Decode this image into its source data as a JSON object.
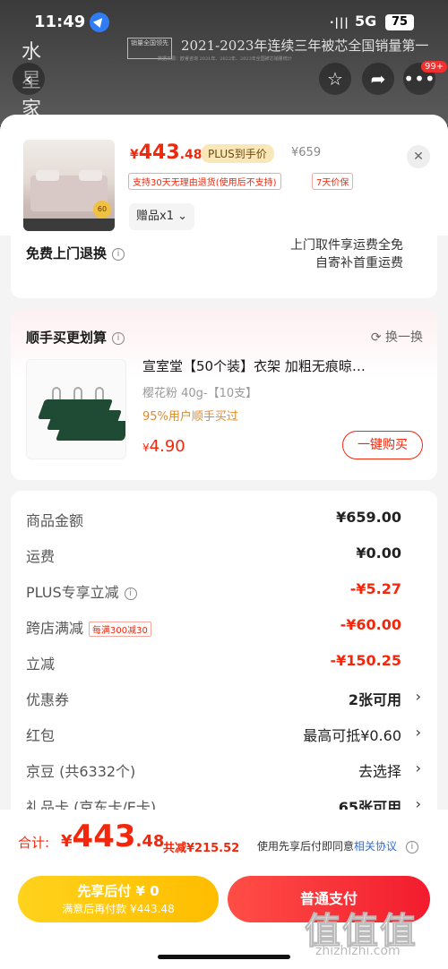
{
  "status_bar": {
    "time": "11:49",
    "signal": "·|||",
    "network": "5G",
    "battery": "75"
  },
  "banner": {
    "logo": "水星家纺",
    "badge": "销量全国领先",
    "slogan": "2021-2023年连续三年被芯全国销量第一",
    "fine_print": "数据来源：欧睿咨询 2021年、2022年、2023年全国被芯销量统计"
  },
  "nav": {
    "more_badge": "99+"
  },
  "product": {
    "currency": "¥",
    "price_int": "443",
    "price_dec": ".48",
    "plus_label": "PLUS到手价",
    "original_price": "¥659",
    "tags": [
      "支持30天无理由退货(使用后不支持)",
      "7天价保"
    ],
    "gift": "赠品x1",
    "thumb_badge": "60"
  },
  "return_service": {
    "title": "免费上门退换",
    "line1": "上门取件享运费全免",
    "line2": "自寄补首重运费"
  },
  "addon": {
    "title": "顺手买更划算",
    "refresh": "换一换",
    "name": "宣室堂【50个装】衣架 加粗无痕晾…",
    "spec": "樱花粉 40g-【10支】",
    "bought": "95%用户顺手买过",
    "currency": "¥",
    "price": "4.90",
    "buy_label": "一键购买"
  },
  "summary": [
    {
      "label": "商品金额",
      "value": "¥659.00",
      "style": "normal",
      "chevron": false
    },
    {
      "label": "运费",
      "value": "¥0.00",
      "style": "normal",
      "chevron": false
    },
    {
      "label": "PLUS专享立减",
      "value": "-¥5.27",
      "style": "red",
      "chevron": false,
      "info": true
    },
    {
      "label": "跨店满减",
      "value": "-¥60.00",
      "style": "red",
      "chevron": false,
      "tag": "每满300减30"
    },
    {
      "label": "立减",
      "value": "-¥150.25",
      "style": "red",
      "chevron": false
    },
    {
      "label": "优惠券",
      "value": "2张可用",
      "style": "normal",
      "chevron": true
    },
    {
      "label": "红包",
      "value": "最高可抵¥0.60",
      "style": "normal",
      "chevron": true
    },
    {
      "label": "京豆 (共6332个)",
      "value": "去选择",
      "style": "light",
      "chevron": true
    },
    {
      "label": "礼品卡 (京东卡/E卡)",
      "value": "65张可用",
      "style": "normal",
      "chevron": true
    }
  ],
  "footer": {
    "total_label": "合计:",
    "currency": "¥",
    "total_int": "443",
    "total_dec": ".48",
    "saved": "共减¥215.52",
    "agree_text": "使用先享后付即同意",
    "agree_link": "相关协议",
    "paylater_l1": "先享后付 ¥ 0",
    "paylater_l2": "满意后再付款 ¥443.48",
    "pay_label": "普通支付"
  },
  "watermark": {
    "main": "值值值",
    "sub": "zhizhizhi.com"
  },
  "colors": {
    "accent_red": "#f2270c",
    "plus_gold": "#f9e7b8",
    "paylater_yellow": "#ffd21c"
  }
}
